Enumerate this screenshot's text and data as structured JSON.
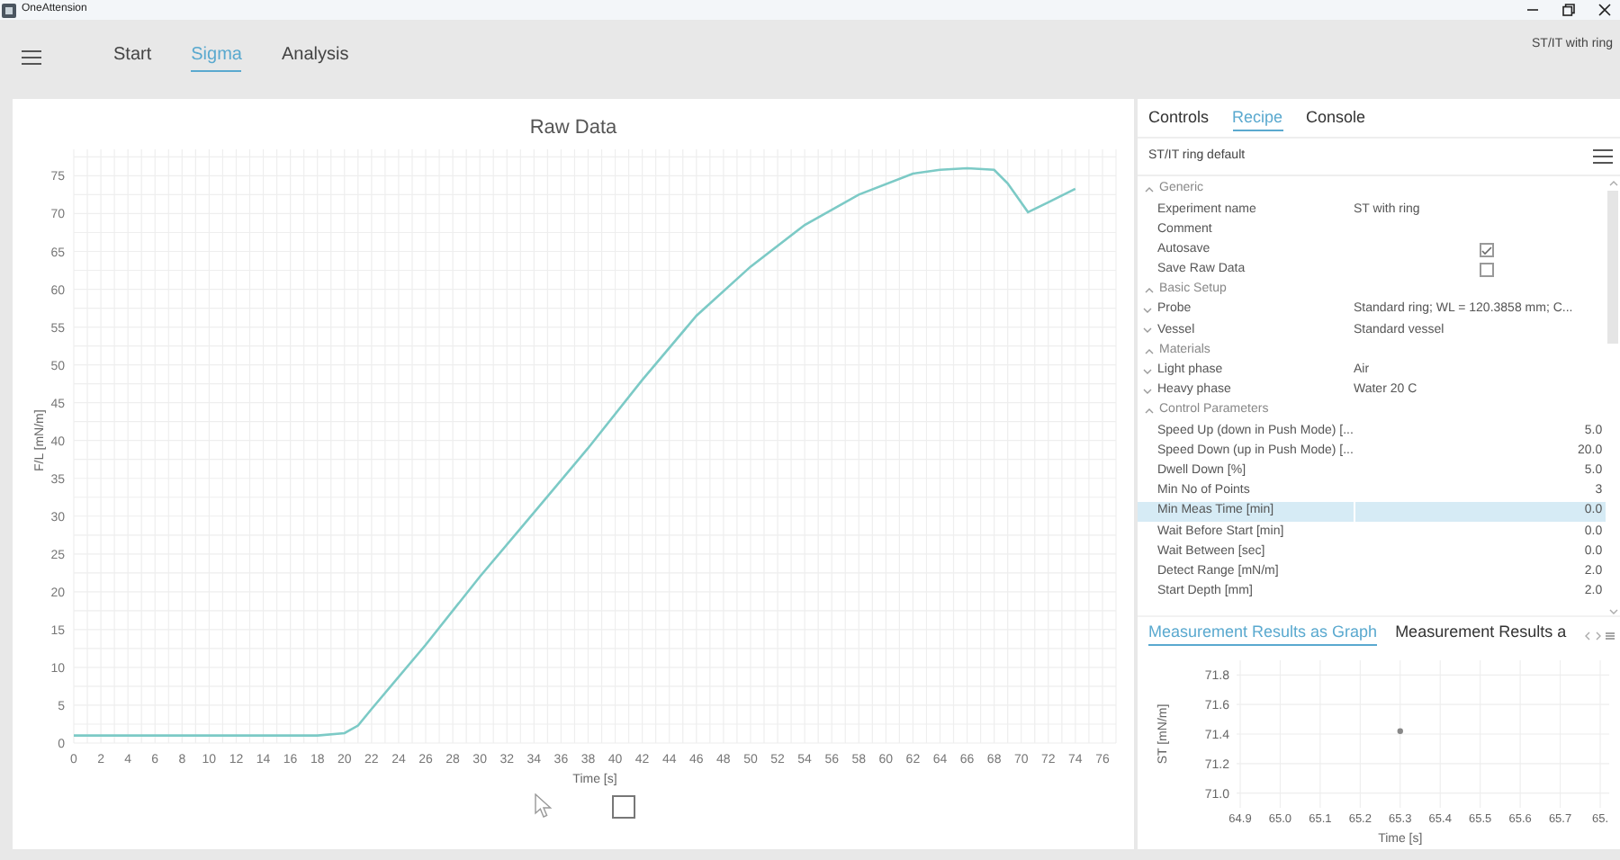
{
  "window": {
    "title": "OneAttension"
  },
  "nav": {
    "tabs": [
      {
        "label": "Start",
        "selected": false
      },
      {
        "label": "Sigma",
        "selected": true
      },
      {
        "label": "Analysis",
        "selected": false
      }
    ],
    "context": "ST/IT with ring"
  },
  "raw_data": {
    "title": "Raw Data",
    "checkbox": {
      "checked": false
    },
    "chart_data": {
      "type": "line",
      "grid": true,
      "xlabel": "Time [s]",
      "ylabel": "F/L [mN/m]",
      "xlim": [
        0,
        77
      ],
      "ylim": [
        0,
        78.5
      ],
      "xticks": [
        0,
        2,
        4,
        6,
        8,
        10,
        12,
        14,
        16,
        18,
        20,
        22,
        24,
        26,
        28,
        30,
        32,
        34,
        36,
        38,
        40,
        42,
        44,
        46,
        48,
        50,
        52,
        54,
        56,
        58,
        60,
        62,
        64,
        66,
        68,
        70,
        72,
        74,
        76
      ],
      "yticks": [
        0,
        5,
        10,
        15,
        20,
        25,
        30,
        35,
        40,
        45,
        50,
        55,
        60,
        65,
        70,
        75
      ],
      "x": [
        0,
        18,
        20,
        21,
        22,
        26,
        30,
        34,
        38,
        42,
        46,
        50,
        54,
        58,
        62,
        64,
        66,
        68,
        69,
        70.5,
        72,
        74
      ],
      "series": [
        {
          "color": "#7ccac6",
          "values": [
            1,
            1,
            1.3,
            2.3,
            4.5,
            13,
            22,
            30.5,
            39,
            48,
            56.5,
            63,
            68.5,
            72.5,
            75.3,
            75.8,
            76,
            75.8,
            74,
            70.2,
            71.5,
            73.3
          ]
        }
      ]
    }
  },
  "side_panel": {
    "tabs": [
      {
        "label": "Controls",
        "selected": false
      },
      {
        "label": "Recipe",
        "selected": true
      },
      {
        "label": "Console",
        "selected": false
      }
    ],
    "recipe": "ST/IT ring default",
    "properties": [
      {
        "name": "Generic",
        "expanded": true,
        "children": [
          {
            "label": "Experiment name",
            "kind": "text",
            "value": "ST with ring",
            "selected": false
          },
          {
            "label": "Comment",
            "kind": "text",
            "selected": false
          },
          {
            "label": "Autosave",
            "kind": "checkbox",
            "checked": true,
            "selected": false
          },
          {
            "label": "Save Raw Data",
            "kind": "checkbox",
            "checked": false,
            "selected": false
          }
        ]
      },
      {
        "name": "Basic Setup",
        "expanded": true,
        "children": [
          {
            "label": "Probe",
            "kind": "expander",
            "expanded": false,
            "value": "Standard ring; WL = 120.3858 mm; C...",
            "selected": false
          },
          {
            "label": "Vessel",
            "kind": "expander",
            "expanded": false,
            "value": "Standard vessel",
            "selected": false
          }
        ]
      },
      {
        "name": "Materials",
        "expanded": true,
        "children": [
          {
            "label": "Light phase",
            "kind": "expander",
            "expanded": false,
            "value": "Air",
            "selected": false
          },
          {
            "label": "Heavy phase",
            "kind": "expander",
            "expanded": false,
            "value": "Water 20 C",
            "selected": false
          }
        ]
      },
      {
        "name": "Control Parameters",
        "expanded": true,
        "children": [
          {
            "label": "Speed Up (down in Push Mode) [...",
            "kind": "number",
            "value": "5.0",
            "selected": false
          },
          {
            "label": "Speed Down (up in Push Mode) [...",
            "kind": "number",
            "value": "20.0",
            "selected": false
          },
          {
            "label": "Dwell Down [%]",
            "kind": "number",
            "value": "5.0",
            "selected": false
          },
          {
            "label": "Min No of Points",
            "kind": "number",
            "value": "3",
            "selected": false
          },
          {
            "label": "Min Meas Time [min]",
            "kind": "number",
            "value": "0.0",
            "selected": true
          },
          {
            "label": "Wait Before Start [min]",
            "kind": "number",
            "value": "0.0",
            "selected": false
          },
          {
            "label": "Wait Between [sec]",
            "kind": "number",
            "value": "0.0",
            "selected": false
          },
          {
            "label": "Detect Range [mN/m]",
            "kind": "number",
            "value": "2.0",
            "selected": false
          },
          {
            "label": "Start Depth [mm]",
            "kind": "number",
            "value": "2.0",
            "selected": false
          }
        ]
      }
    ]
  },
  "results": {
    "edge_tick_label": "65.",
    "tabs": [
      {
        "label": "Measurement Results as Graph",
        "selected": true
      },
      {
        "label": "Measurement Results a",
        "selected": false
      }
    ],
    "chart_data": {
      "type": "scatter",
      "grid": true,
      "xlabel": "Time [s]",
      "ylabel": "ST [mN/m]",
      "xlim": [
        64.9,
        65.8
      ],
      "ylim": [
        70.9,
        71.9
      ],
      "xticks": [
        {
          "value": 64.9,
          "label": "64.9"
        },
        {
          "value": 65.0,
          "label": "65.0"
        },
        {
          "value": 65.1,
          "label": "65.1"
        },
        {
          "value": 65.2,
          "label": "65.2"
        },
        {
          "value": 65.3,
          "label": "65.3"
        },
        {
          "value": 65.4,
          "label": "65.4"
        },
        {
          "value": 65.5,
          "label": "65.5"
        },
        {
          "value": 65.6,
          "label": "65.6"
        },
        {
          "value": 65.7,
          "label": "65.7"
        }
      ],
      "yticks": [
        {
          "value": 71.0,
          "label": "71.0"
        },
        {
          "value": 71.2,
          "label": "71.2"
        },
        {
          "value": 71.4,
          "label": "71.4"
        },
        {
          "value": 71.6,
          "label": "71.6"
        },
        {
          "value": 71.8,
          "label": "71.8"
        }
      ],
      "x": [
        65.3
      ],
      "series": [
        {
          "color": "#888888",
          "values": [
            71.42
          ]
        }
      ]
    }
  }
}
